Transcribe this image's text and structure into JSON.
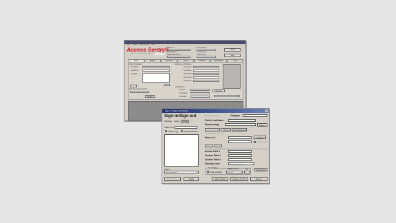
{
  "main_window": {
    "menu_items": [
      "Setup",
      "Reports",
      "Guest Services",
      "Help"
    ],
    "logo_text": "Access Sentry®",
    "logo_subtitle": "Visitor & Contractor Management",
    "header_fields": [
      "Visitor ID",
      "Card Number",
      "Workstation Name"
    ],
    "header_right_fields": [
      "Current Date",
      "Current Time",
      "Guard Level"
    ],
    "header_buttons": [
      "Cancel",
      "Save"
    ],
    "tabs": [
      "Home",
      "Badges",
      "Contractor",
      "Visitor",
      "Incidents",
      "Permissions",
      "Logs"
    ],
    "sections": {
      "visitor": "Visitor Information",
      "employee": "Employee Information",
      "search": "Employee Name Search",
      "identification": "Identification"
    },
    "left_fields": [
      "First Name",
      "Last Name",
      "Company"
    ],
    "employee_fields": [
      "First Name",
      "Last Name",
      "Work Phone",
      "Dept Code",
      "Department"
    ],
    "identification_fields": [
      "ID Type",
      "ID Number",
      "Expiration"
    ],
    "search_button": "Search",
    "sign_out_button": "Sign Out"
  },
  "dialog": {
    "title": "Sign-In / Sign-out Visitors",
    "heading": "Sign-in/Sign-out",
    "pending_label": "Pending",
    "active_label": "Active",
    "today_label": "Today",
    "search_for_label": "Search for",
    "radio_active_log": "Active Log",
    "radio_search_results": "Search Results",
    "show_label": "Show",
    "show_value": "Main Building",
    "left_buttons": [
      "Print Badge",
      "Apply"
    ],
    "visitor_status_label": "Visitor's Status",
    "category_label": "Category",
    "category_value": "Visitor",
    "first_last_label": "First & Last Name",
    "history_button": "History",
    "representing_label": "Representing",
    "photo_buttons": [
      "Capture Photo",
      "Photo",
      "Get Signature"
    ],
    "optional_label": "Optional (Reply) data",
    "name_label": "Name or #",
    "lookup_button": "Lookup",
    "send_email_label": "Send E-mail",
    "small_buttons": [
      "Edit",
      "Delete"
    ],
    "access_card_label": "Access Card #",
    "custom_field_1_label": "Custom Field 1",
    "custom_field_2_label": "Custom Field 2",
    "security_level_label": "Security Level",
    "security_level_value": "Escort Required",
    "print_badge_label": "Print Badge",
    "badge_layout_label": "Badge Layout",
    "qty_label": "Qty",
    "automatically_label": "Automatically",
    "badge_layout_value": "Visitor",
    "qty_value": "1",
    "show_more_button": "Show More",
    "bottom_buttons": [
      "Add Another",
      "Sign-in & New",
      "Sign-in"
    ]
  }
}
